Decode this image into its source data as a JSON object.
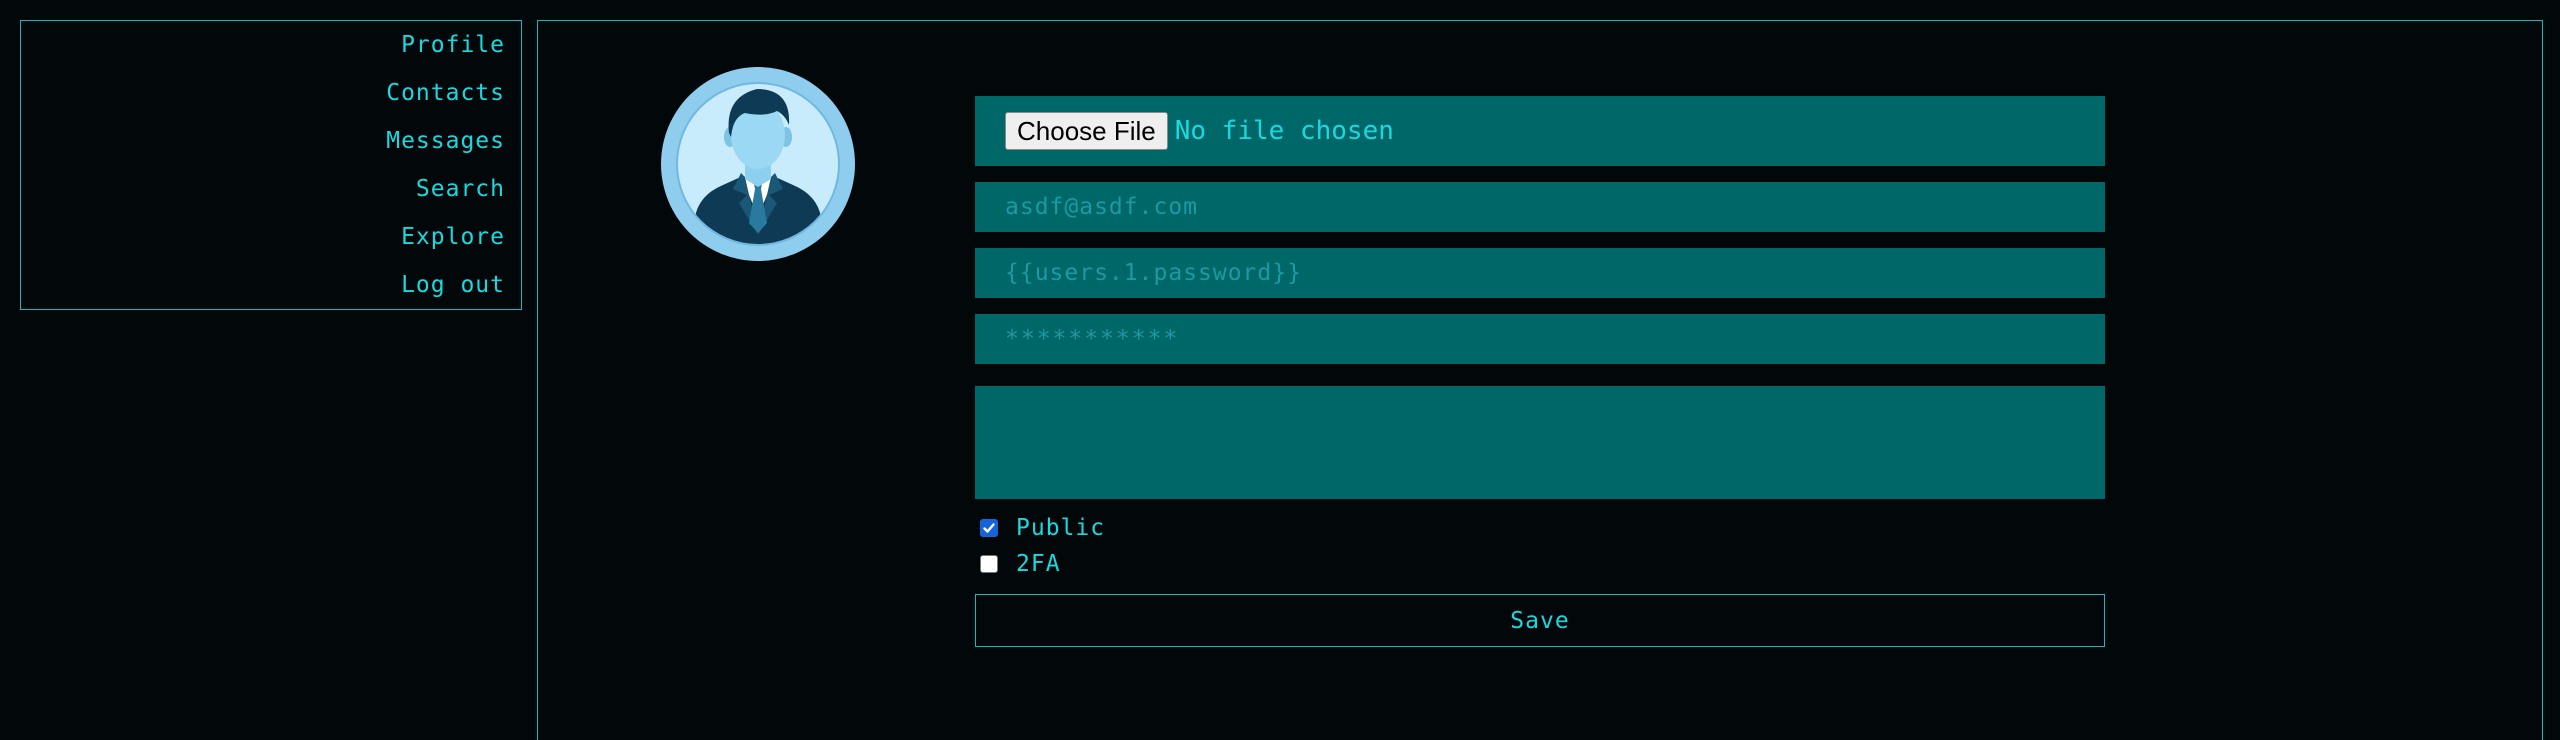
{
  "sidebar": {
    "items": [
      {
        "label": "Profile"
      },
      {
        "label": "Contacts"
      },
      {
        "label": "Messages"
      },
      {
        "label": "Search"
      },
      {
        "label": "Explore"
      },
      {
        "label": "Log out"
      }
    ]
  },
  "profile": {
    "avatar_icon": "user-avatar-icon",
    "file_input": {
      "button_label": "Choose File",
      "status": "No file chosen"
    },
    "email_placeholder": "asdf@asdf.com",
    "password_placeholder": "{{users.1.password}}",
    "confirm_password_value": "***********",
    "bio_value": "",
    "public": {
      "label": "Public",
      "checked": true
    },
    "two_fa": {
      "label": "2FA",
      "checked": false
    },
    "save_label": "Save"
  },
  "colors": {
    "background": "#02080a",
    "accent": "#19d9df",
    "field_fill": "#006768",
    "border": "#19b6c2"
  }
}
